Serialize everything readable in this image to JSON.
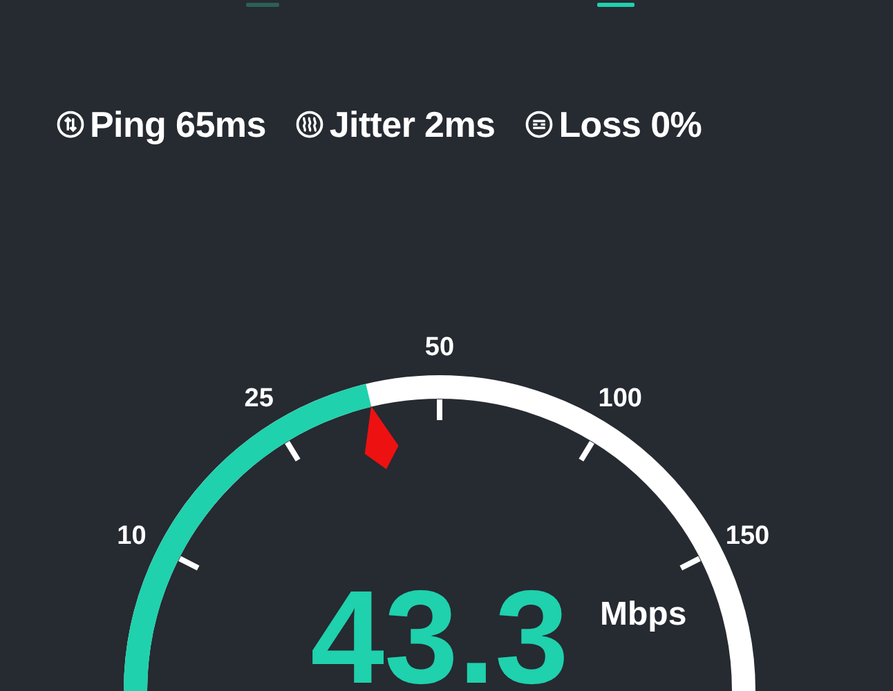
{
  "tabs": [
    {
      "selected": false
    },
    {
      "selected": true
    }
  ],
  "stats": [
    {
      "kind": "ping",
      "label": "Ping 65ms"
    },
    {
      "kind": "jitter",
      "label": "Jitter 2ms"
    },
    {
      "kind": "loss",
      "label": "Loss 0%"
    }
  ],
  "gauge": {
    "ticks": [
      "10",
      "25",
      "50",
      "100",
      "150"
    ],
    "value": "43.3",
    "unit": "Mbps"
  }
}
